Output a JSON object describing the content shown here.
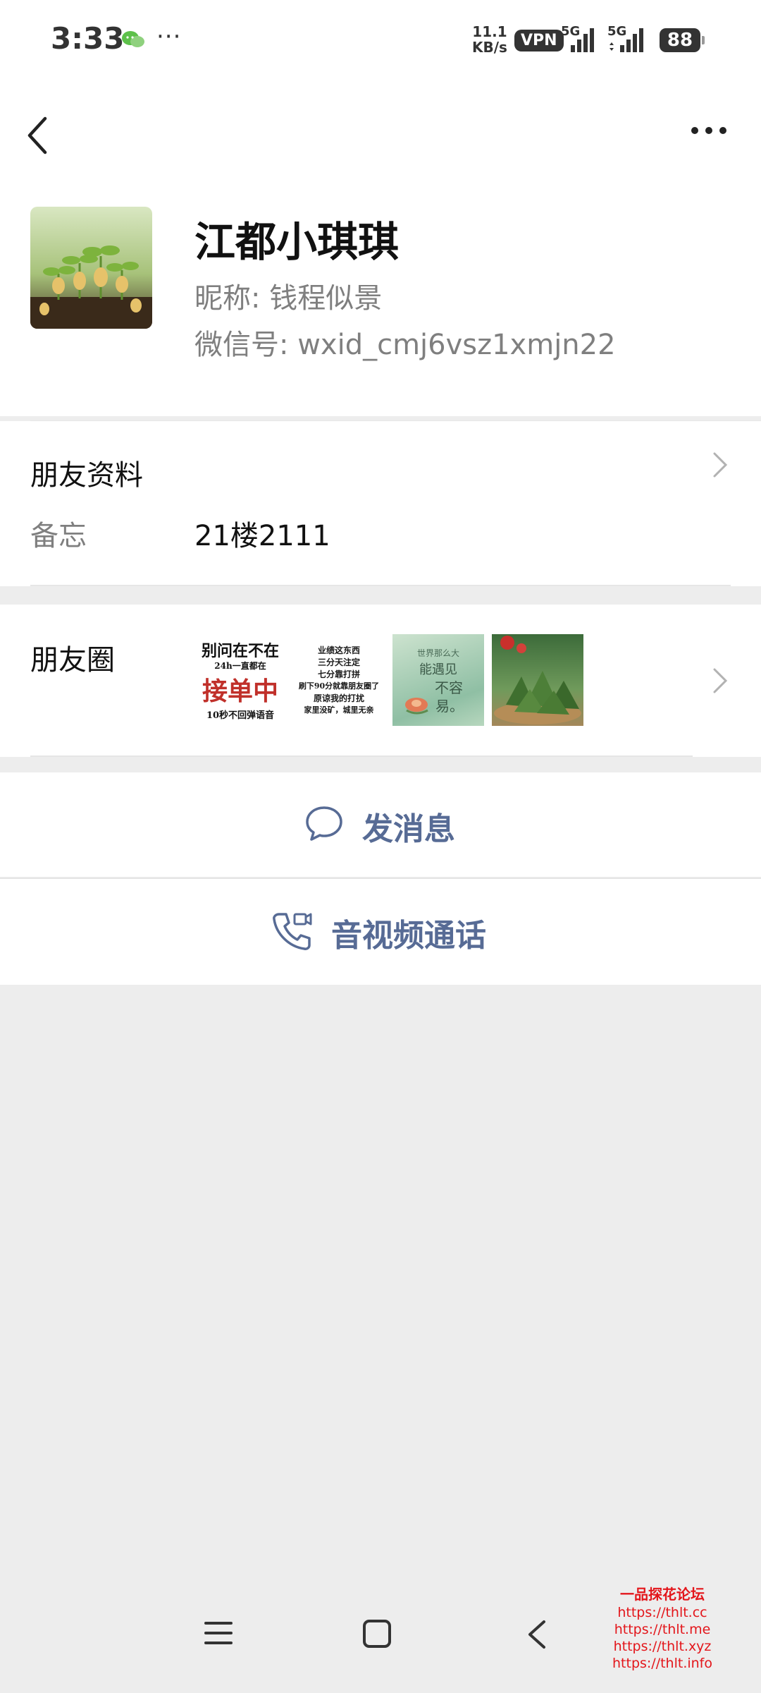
{
  "status_bar": {
    "time": "3:33",
    "more": "···",
    "net_speed_value": "11.1",
    "net_speed_unit": "KB/s",
    "vpn": "VPN",
    "sim1": "5G",
    "sim2": "5G",
    "battery": "88"
  },
  "header": {
    "back_icon": "chevron-left-icon",
    "menu_icon": "more-horizontal-icon"
  },
  "contact": {
    "display_name": "江都小琪琪",
    "nickname": "昵称:  钱程似景",
    "wechat_id": "微信号:  wxid_cmj6vsz1xmjn22"
  },
  "profile": {
    "title": "朋友资料",
    "remark_label": "备忘",
    "remark_value": "21楼2111"
  },
  "moments": {
    "title": "朋友圈",
    "thumbs": [
      {
        "line1": "别问在不在",
        "line2": "24h一直都在",
        "line3": "接单中",
        "line4": "10秒不回弹语音"
      },
      {
        "line1": "业绩这东西",
        "line2": "三分天注定",
        "line3": "七分靠打拼",
        "line4": "刷下90分就靠朋友圈了",
        "line5": "原谅我的打扰",
        "line6": "家里没矿，城里无亲"
      },
      {
        "line1": "世界那么大",
        "line2": "能遇见",
        "line3": "不容",
        "line4": "易。"
      },
      {}
    ]
  },
  "actions": {
    "message": "发消息",
    "call": "音视频通话"
  },
  "watermark": {
    "title": "一品探花论坛",
    "links": [
      "https://thlt.cc",
      "https://thlt.me",
      "https://thlt.xyz",
      "https://thlt.info"
    ]
  },
  "colors": {
    "link_blue": "#576b95",
    "background": "#ededed",
    "watermark_red": "#e3161b"
  }
}
